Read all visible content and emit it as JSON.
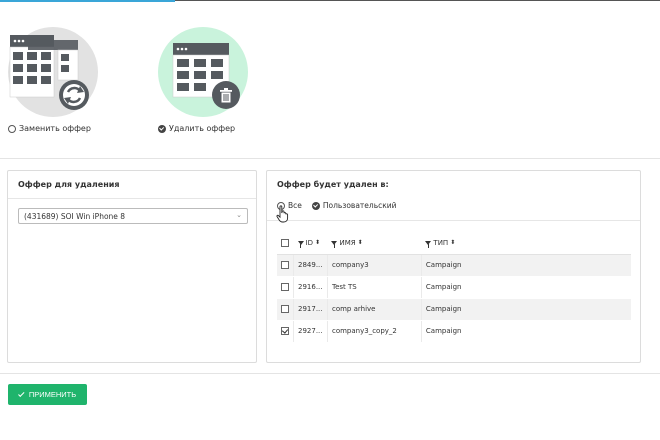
{
  "colors": {
    "accent": "#3aa6d8",
    "apply": "#1fb46c",
    "replace_circle": "#e2e2e2",
    "delete_circle": "#c9f3dc",
    "icon_dark": "#555a5f"
  },
  "options": {
    "replace": {
      "label": "Заменить оффер",
      "icon": "table-refresh-icon",
      "selected": false
    },
    "delete": {
      "label": "Удалить оффер",
      "icon": "table-trash-icon",
      "selected": true
    }
  },
  "left_panel": {
    "title": "Оффер для удаления",
    "select_value": "(431689) SOI Win iPhone 8"
  },
  "right_panel": {
    "title": "Оффер будет удален в:",
    "scope_all": "Все",
    "scope_custom": "Пользовательский",
    "columns": {
      "id": "ID",
      "name": "ИМЯ",
      "type": "ТИП"
    },
    "rows": [
      {
        "id": "2849...",
        "name": "company3",
        "type": "Campaign",
        "checked": false
      },
      {
        "id": "2916...",
        "name": "Test TS",
        "type": "Campaign",
        "checked": false
      },
      {
        "id": "2917...",
        "name": "comp arhive",
        "type": "Campaign",
        "checked": false
      },
      {
        "id": "2927...",
        "name": "company3_copy_2",
        "type": "Campaign",
        "checked": true
      }
    ]
  },
  "apply_label": "ПРИМЕНИТЬ"
}
